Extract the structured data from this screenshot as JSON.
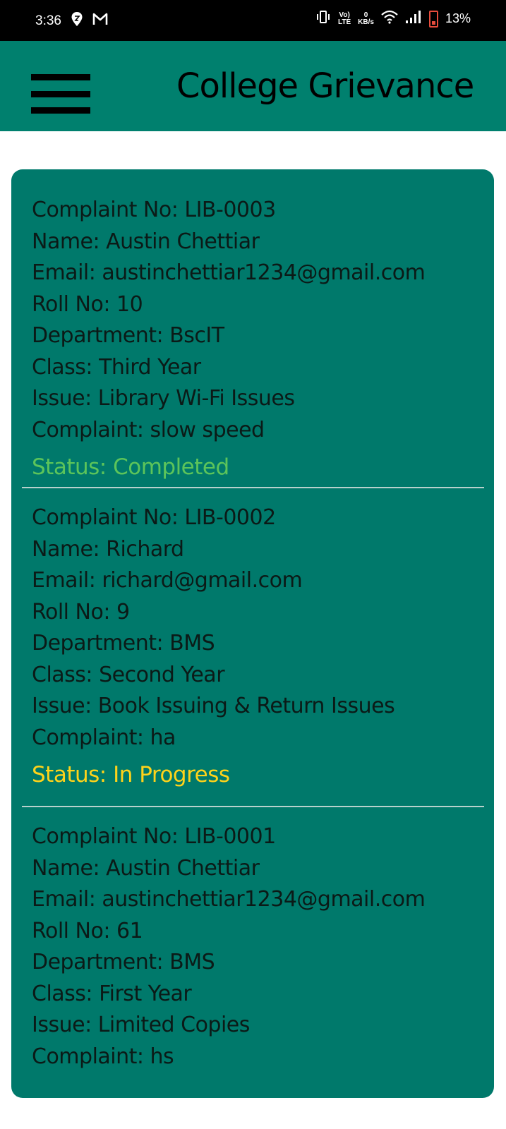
{
  "status_bar": {
    "time": "3:36",
    "icons_left": [
      "location-icon",
      "gmail-icon"
    ],
    "volte_top": "Vo)",
    "volte_bottom": "LTE",
    "speed_top": "0",
    "speed_bottom": "KB/s",
    "battery": "13%"
  },
  "app_bar": {
    "title": "College Grievance",
    "color": "#00806e"
  },
  "colors": {
    "card": "#00796b",
    "status_completed": "#5cc45a",
    "status_in_progress": "#ffd31a"
  },
  "complaints": [
    {
      "complaint_no": "Complaint No: LIB-0003",
      "name": "Name: Austin Chettiar",
      "email": "Email: austinchettiar1234@gmail.com",
      "roll_no": "Roll No: 10",
      "department": "Department: BscIT",
      "class": "Class: Third Year",
      "issue": "Issue: Library Wi-Fi Issues",
      "complaint": "Complaint: slow speed",
      "status": "Status: Completed"
    },
    {
      "complaint_no": "Complaint No: LIB-0002",
      "name": "Name: Richard",
      "email": "Email: richard@gmail.com",
      "roll_no": "Roll No: 9",
      "department": "Department: BMS",
      "class": "Class: Second Year",
      "issue": "Issue: Book Issuing & Return Issues",
      "complaint": "Complaint: ha",
      "status": "Status: In Progress"
    },
    {
      "complaint_no": "Complaint No: LIB-0001",
      "name": "Name: Austin Chettiar",
      "email": "Email: austinchettiar1234@gmail.com",
      "roll_no": "Roll No: 61",
      "department": "Department: BMS",
      "class": "Class: First Year",
      "issue": "Issue: Limited Copies",
      "complaint": "Complaint: hs"
    }
  ]
}
